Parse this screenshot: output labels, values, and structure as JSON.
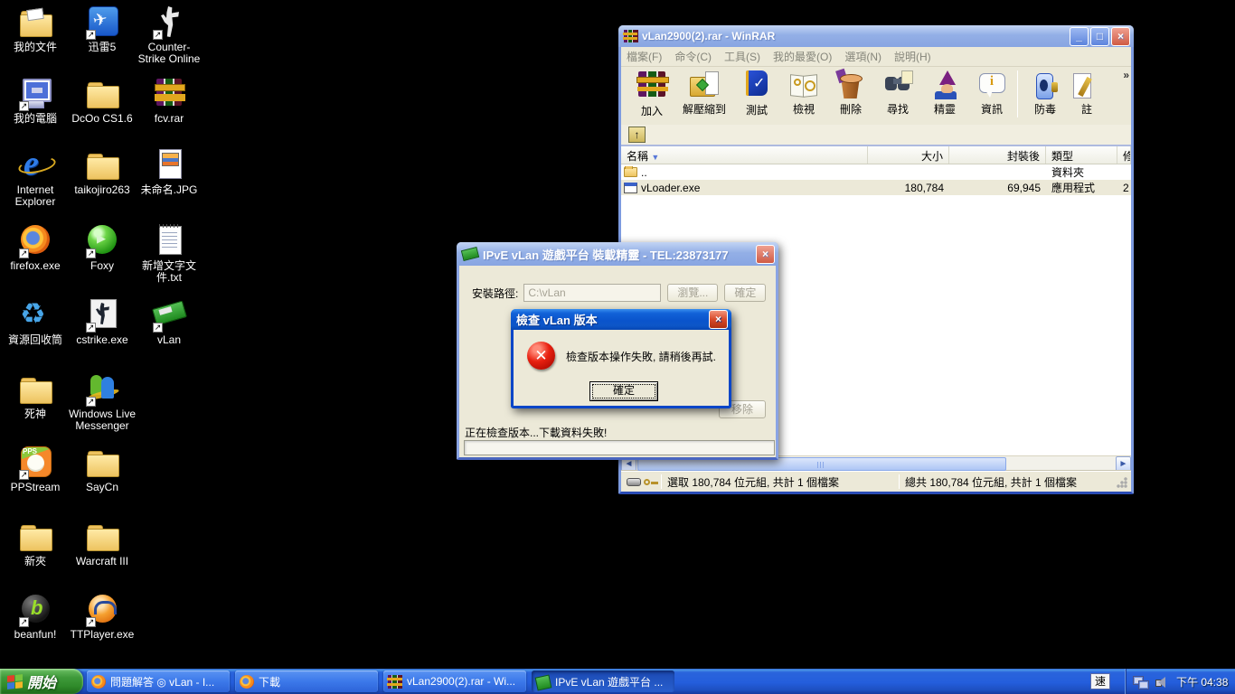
{
  "colors": {
    "desktop_bg": "#000000",
    "taskbar_blue": "#245edc",
    "start_green": "#3f9a3a",
    "title_active_blue": "#0a54cc",
    "title_inactive_blue": "#93afe6",
    "selection_beige": "#ece9d8",
    "error_red": "#e82010"
  },
  "desktop": {
    "icons": [
      {
        "label": "我的文件",
        "icon": "my-documents-icon"
      },
      {
        "label": "迅雷5",
        "icon": "thunder5-icon"
      },
      {
        "label": "Counter-Strike Online",
        "icon": "counter-strike-online-icon"
      },
      {
        "label": "我的電腦",
        "icon": "my-computer-icon"
      },
      {
        "label": "DcOo CS1.6",
        "icon": "folder-icon"
      },
      {
        "label": "fcv.rar",
        "icon": "winrar-archive-icon"
      },
      {
        "label": "Internet Explorer",
        "icon": "internet-explorer-icon"
      },
      {
        "label": "taikojiro263",
        "icon": "folder-icon"
      },
      {
        "label": "未命名.JPG",
        "icon": "image-file-icon"
      },
      {
        "label": "firefox.exe",
        "icon": "firefox-icon"
      },
      {
        "label": "Foxy",
        "icon": "foxy-icon"
      },
      {
        "label": "新增文字文件.txt",
        "icon": "text-file-icon"
      },
      {
        "label": "資源回收筒",
        "icon": "recycle-bin-icon"
      },
      {
        "label": "cstrike.exe",
        "icon": "cstrike-icon"
      },
      {
        "label": "vLan",
        "icon": "vlan-icon"
      },
      {
        "label": "死神",
        "icon": "folder-icon"
      },
      {
        "label": "Windows Live Messenger",
        "icon": "messenger-icon"
      },
      {
        "label": "PPStream",
        "icon": "ppstream-icon"
      },
      {
        "label": "SayCn",
        "icon": "folder-icon"
      },
      {
        "label": "新夾",
        "icon": "folder-icon"
      },
      {
        "label": "Warcraft III",
        "icon": "folder-icon"
      },
      {
        "label": "beanfun!",
        "icon": "beanfun-icon"
      },
      {
        "label": "TTPlayer.exe",
        "icon": "ttplayer-icon"
      }
    ]
  },
  "winrar": {
    "title": "vLan2900(2).rar - WinRAR",
    "menus": [
      "檔案(F)",
      "命令(C)",
      "工具(S)",
      "我的最愛(O)",
      "選項(N)",
      "說明(H)"
    ],
    "overflow": "»",
    "up_arrow": "↑",
    "toolbar": [
      {
        "label": "加入",
        "icon": "add-icon"
      },
      {
        "label": "解壓縮到",
        "icon": "extract-to-icon"
      },
      {
        "label": "測試",
        "icon": "test-icon"
      },
      {
        "label": "檢視",
        "icon": "view-icon"
      },
      {
        "label": "刪除",
        "icon": "delete-icon"
      },
      {
        "label": "尋找",
        "icon": "find-icon"
      },
      {
        "label": "精靈",
        "icon": "wizard-icon"
      },
      {
        "label": "資訊",
        "icon": "info-icon"
      },
      {
        "label": "防毒",
        "icon": "antivirus-icon"
      },
      {
        "label": "註",
        "icon": "comment-icon"
      }
    ],
    "columns": {
      "name": "名稱",
      "size": "大小",
      "packed": "封裝後",
      "type": "類型",
      "date": "修"
    },
    "sort_arrow": "▼",
    "rows": [
      {
        "name": "..",
        "size": "",
        "packed": "",
        "type": "資料夾",
        "date": ""
      },
      {
        "name": "vLoader.exe",
        "size": "180,784",
        "packed": "69,945",
        "type": "應用程式",
        "date": "2"
      }
    ],
    "status_left": "選取 180,784 位元組, 共計 1 個檔案",
    "status_right": "總共 180,784 位元組, 共計 1 個檔案",
    "scroll_left_arrow": "◄",
    "scroll_right_arrow": "►"
  },
  "installer": {
    "title": "IPvE vLan 遊戲平台 裝載精靈 - TEL:23873177",
    "close_glyph": "×",
    "path_label": "安裝路徑:",
    "path_value": "C:\\vLan",
    "browse_label": "瀏覽...",
    "ok_label": "確定",
    "remove_label": "移除",
    "status_text": "正在檢查版本...下載資料失敗!"
  },
  "error_dialog": {
    "title": "檢查 vLan 版本",
    "close_glyph": "×",
    "error_glyph": "✕",
    "message": "檢查版本操作失敗, 請稍後再試.",
    "ok_label": "確定"
  },
  "taskbar": {
    "start_label": "開始",
    "tasks": [
      {
        "label": "問題解答 ◎ vLan - I...",
        "icon": "firefox-icon"
      },
      {
        "label": "下載",
        "icon": "firefox-icon"
      },
      {
        "label": "vLan2900(2).rar - Wi...",
        "icon": "winrar-icon"
      },
      {
        "label": "IPvE vLan 遊戲平台 ...",
        "icon": "vlan-icon"
      }
    ],
    "ime_indicator": "速",
    "clock": "下午 04:38"
  }
}
